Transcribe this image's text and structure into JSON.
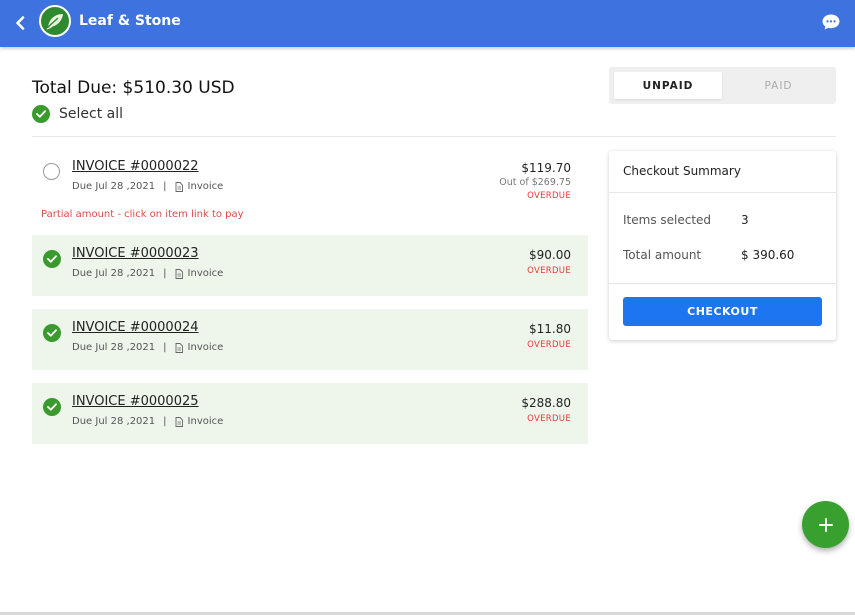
{
  "header": {
    "brand": "Leaf & Stone",
    "back_icon": "chevron-left-icon",
    "chat_icon": "chat-bubble-icon",
    "color": "#3d72df"
  },
  "summary_top": {
    "total_due": "Total Due: $510.30 USD",
    "select_all": "Select all"
  },
  "tabs": [
    {
      "label": "UNPAID",
      "active": true
    },
    {
      "label": "PAID",
      "active": false
    }
  ],
  "invoices": [
    {
      "title": "INVOICE #0000022",
      "due": "Due Jul 28 ,2021",
      "type": "Invoice",
      "amount": "$119.70",
      "out_of": "Out of $269.75",
      "status": "OVERDUE",
      "selected": false
    },
    {
      "title": "INVOICE #0000023",
      "due": "Due Jul 28 ,2021",
      "type": "Invoice",
      "amount": "$90.00",
      "status": "OVERDUE",
      "selected": true
    },
    {
      "title": "INVOICE #0000024",
      "due": "Due Jul 28 ,2021",
      "type": "Invoice",
      "amount": "$11.80",
      "status": "OVERDUE",
      "selected": true
    },
    {
      "title": "INVOICE #0000025",
      "due": "Due Jul 28 ,2021",
      "type": "Invoice",
      "amount": "$288.80",
      "status": "OVERDUE",
      "selected": true
    }
  ],
  "partial_note": "Partial amount - click on item link to pay",
  "checkout_summary": {
    "title": "Checkout Summary",
    "items_label": "Items selected",
    "items_value": "3",
    "total_label": "Total amount",
    "total_value": "$ 390.60",
    "button": "CHECKOUT"
  },
  "fab_icon": "plus-icon",
  "colors": {
    "accent_green": "#3a9a2e",
    "overdue_red": "#e53b3b",
    "checkout_blue": "#1e75f0",
    "selected_row_bg": "#eef6ec"
  }
}
